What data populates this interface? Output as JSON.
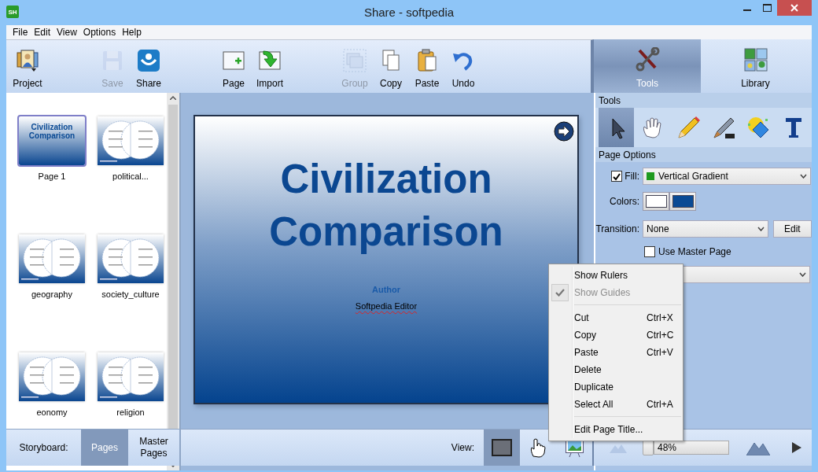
{
  "window": {
    "app_icon": "SH",
    "title": "Share - softpedia"
  },
  "menu": [
    "File",
    "Edit",
    "View",
    "Options",
    "Help"
  ],
  "toolbar": [
    [
      {
        "label": "Project",
        "disabled": false
      }
    ],
    [
      {
        "label": "Save",
        "disabled": true
      },
      {
        "label": "Share",
        "disabled": false
      }
    ],
    [
      {
        "label": "Page",
        "disabled": false
      },
      {
        "label": "Import",
        "disabled": false
      }
    ],
    [
      {
        "label": "Group",
        "disabled": true
      },
      {
        "label": "Copy",
        "disabled": false
      },
      {
        "label": "Paste",
        "disabled": false
      },
      {
        "label": "Undo",
        "disabled": false
      }
    ]
  ],
  "panel_tabs": [
    {
      "label": "Tools",
      "selected": true
    },
    {
      "label": "Library",
      "selected": false
    }
  ],
  "storyboard": {
    "pages": [
      {
        "label": "Page 1",
        "selected": true,
        "kind": "title",
        "thumb_title": "Civilization Comparison"
      },
      {
        "label": "political...",
        "selected": false,
        "kind": "venn"
      },
      {
        "label": "geography",
        "selected": false,
        "kind": "venn"
      },
      {
        "label": "society_culture",
        "selected": false,
        "kind": "venn"
      },
      {
        "label": "eonomy",
        "selected": false,
        "kind": "venn"
      },
      {
        "label": "religion",
        "selected": false,
        "kind": "venn"
      }
    ],
    "label": "Storyboard:",
    "tabs": [
      {
        "label": "Pages",
        "selected": true
      },
      {
        "label": "Master Pages",
        "selected": false
      }
    ]
  },
  "slide": {
    "title": "Civilization Comparison",
    "author_label": "Author",
    "author": "Softpedia Editor"
  },
  "tools": {
    "header": "Tools",
    "items": [
      {
        "selected": true
      },
      {
        "selected": false
      },
      {
        "selected": false
      },
      {
        "selected": false
      },
      {
        "selected": false
      },
      {
        "selected": false
      }
    ]
  },
  "page_options": {
    "header": "Page Options",
    "fill": {
      "label": "Fill:",
      "checked": true,
      "value": "Vertical Gradient"
    },
    "colors": {
      "label": "Colors:",
      "swatches": [
        {
          "color": "#ffffff"
        },
        {
          "color": "#0a4a94"
        }
      ]
    },
    "transition": {
      "label": "Transition:",
      "value": "None",
      "button": "Edit"
    },
    "use_master_page": {
      "label": "Use Master Page",
      "checked": false
    }
  },
  "view": {
    "label": "View:",
    "buttons": [
      {
        "selected": true
      },
      {
        "selected": false
      },
      {
        "selected": false
      }
    ]
  },
  "zoom": {
    "value": "48%"
  },
  "context_menu": [
    {
      "kind": "item",
      "label": "Show Rulers",
      "checked": false,
      "disabled": false
    },
    {
      "kind": "item",
      "label": "Show Guides",
      "checked": true,
      "disabled": true
    },
    {
      "kind": "separator"
    },
    {
      "kind": "item",
      "label": "Cut",
      "shortcut": "Ctrl+X",
      "checked": false,
      "disabled": false
    },
    {
      "kind": "item",
      "label": "Copy",
      "shortcut": "Ctrl+C",
      "checked": false,
      "disabled": false
    },
    {
      "kind": "item",
      "label": "Paste",
      "shortcut": "Ctrl+V",
      "checked": false,
      "disabled": false
    },
    {
      "kind": "item",
      "label": "Delete",
      "checked": false,
      "disabled": false
    },
    {
      "kind": "item",
      "label": "Duplicate",
      "checked": false,
      "disabled": false
    },
    {
      "kind": "item",
      "label": "Select All",
      "shortcut": "Ctrl+A",
      "checked": false,
      "disabled": false
    },
    {
      "kind": "separator"
    },
    {
      "kind": "item",
      "label": "Edit Page Title...",
      "checked": false,
      "disabled": false
    }
  ]
}
